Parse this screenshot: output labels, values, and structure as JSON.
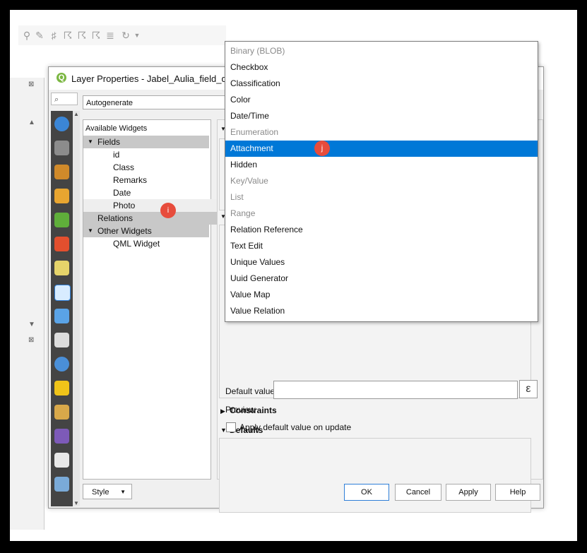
{
  "dialog": {
    "title": "Layer Properties - Jabel_Aulia_field_data",
    "search_icon": "search-icon",
    "combo_value": "Autogenerate"
  },
  "tree": {
    "header": "Available Widgets",
    "fields": {
      "label": "Fields",
      "items": [
        "id",
        "Class",
        "Remarks",
        "Date",
        "Photo"
      ]
    },
    "relations": "Relations",
    "other_widgets": {
      "label": "Other Widgets",
      "items": [
        "QML Widget"
      ]
    }
  },
  "dropdown": {
    "items": [
      {
        "label": "Binary (BLOB)",
        "enabled": false
      },
      {
        "label": "Checkbox",
        "enabled": true
      },
      {
        "label": "Classification",
        "enabled": true
      },
      {
        "label": "Color",
        "enabled": true
      },
      {
        "label": "Date/Time",
        "enabled": true
      },
      {
        "label": "Enumeration",
        "enabled": false
      },
      {
        "label": "Attachment",
        "enabled": true,
        "highlighted": true
      },
      {
        "label": "Hidden",
        "enabled": true
      },
      {
        "label": "Key/Value",
        "enabled": false
      },
      {
        "label": "List",
        "enabled": false
      },
      {
        "label": "Range",
        "enabled": false
      },
      {
        "label": "Relation Reference",
        "enabled": true
      },
      {
        "label": "Text Edit",
        "enabled": true
      },
      {
        "label": "Unique Values",
        "enabled": true
      },
      {
        "label": "Uuid Generator",
        "enabled": true
      },
      {
        "label": "Value Map",
        "enabled": true
      },
      {
        "label": "Value Relation",
        "enabled": true
      }
    ]
  },
  "sections": {
    "constraints": "Constraints",
    "defaults": "Defaults",
    "default_value_label": "Default value",
    "preview_label": "Preview",
    "apply_default_label": "Apply default value on update",
    "expression_symbol": "ε"
  },
  "buttons": {
    "style": "Style",
    "ok": "OK",
    "cancel": "Cancel",
    "apply": "Apply",
    "help": "Help"
  },
  "markers": {
    "i": "i",
    "j": "j"
  },
  "colors": {
    "highlight": "#0078d7",
    "marker": "#e74c3c",
    "qgis_green": "#7bb742"
  }
}
